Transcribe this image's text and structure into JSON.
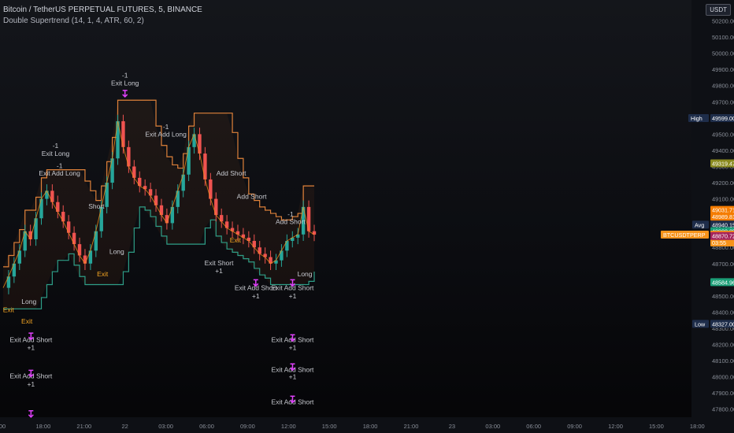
{
  "header": {
    "title": "Bitcoin / TetherUS PERPETUAL FUTURES, 5, BINANCE",
    "indicator": "Double Supertrend (14, 1, 4, ATR, 60, 2)"
  },
  "currency_button": "USDT",
  "colors": {
    "up": "#26a69a",
    "down": "#ef5350",
    "wick_up": "#26a69a",
    "wick_down": "#ef5350",
    "supertrend_up": "#2e9e87",
    "supertrend_down": "#e0823a",
    "exit_marker": "#e040fb",
    "long_marker": "#4dd0e1",
    "exit_text": "#f5a623",
    "price_tag": "#f7931a",
    "avg_tag": "#1e2d4a",
    "high_tag": "#1e2d4a",
    "low_tag": "#1e2d4a"
  },
  "chart_data": {
    "type": "line",
    "title": "Bitcoin / TetherUS PERPETUAL FUTURES, 5, BINANCE",
    "ylim": [
      47750,
      50300
    ],
    "y_ticks": [
      "50200.00",
      "50100.00",
      "50000.00",
      "49900.00",
      "49800.00",
      "49700.00",
      "49600.00",
      "49500.00",
      "49400.00",
      "49300.00",
      "49200.00",
      "49100.00",
      "49000.00",
      "48900.00",
      "48800.00",
      "48700.00",
      "48600.00",
      "48500.00",
      "48400.00",
      "48300.00",
      "48200.00",
      "48100.00",
      "48000.00",
      "47900.00",
      "47800.00"
    ],
    "x_ticks": [
      {
        "label": "00",
        "t": 0
      },
      {
        "label": "18:00",
        "t": 1
      },
      {
        "label": "21:00",
        "t": 2
      },
      {
        "label": "22",
        "t": 3
      },
      {
        "label": "03:00",
        "t": 4
      },
      {
        "label": "06:00",
        "t": 5
      },
      {
        "label": "09:00",
        "t": 6
      },
      {
        "label": "12:00",
        "t": 7
      },
      {
        "label": "15:00",
        "t": 8
      },
      {
        "label": "18:00",
        "t": 9
      },
      {
        "label": "21:00",
        "t": 10
      },
      {
        "label": "23",
        "t": 11
      },
      {
        "label": "03:00",
        "t": 12
      },
      {
        "label": "06:00",
        "t": 13
      },
      {
        "label": "09:00",
        "t": 14
      },
      {
        "label": "12:00",
        "t": 15
      },
      {
        "label": "15:00",
        "t": 16
      },
      {
        "label": "18:00",
        "t": 17
      }
    ],
    "price_close": [
      48550,
      48620,
      48700,
      48780,
      48900,
      48850,
      48980,
      49100,
      49150,
      49080,
      49020,
      48960,
      48890,
      48820,
      48750,
      48700,
      48780,
      48900,
      49050,
      49200,
      49350,
      49580,
      49420,
      49300,
      49230,
      49180,
      49160,
      49120,
      49060,
      49000,
      48950,
      49050,
      49150,
      49250,
      49420,
      49500,
      49380,
      49220,
      49100,
      49000,
      48960,
      48920,
      48900,
      48880,
      48860,
      48840,
      48800,
      48760,
      48740,
      48700,
      48720,
      48780,
      48840,
      48860,
      48880,
      49050,
      48900,
      48878.79
    ],
    "series": [
      {
        "name": "",
        "values": []
      }
    ],
    "price_labels": [
      {
        "label": "High",
        "value": "49599.00"
      },
      {
        "label": "",
        "value": "49319.47"
      },
      {
        "label": "",
        "value": "49031.71"
      },
      {
        "label": "",
        "value": "48989.81"
      },
      {
        "label": "Avg",
        "value": "48940.15"
      },
      {
        "label": "",
        "value": "48900.25"
      },
      {
        "label": "BTCUSDTPERP",
        "value": "48878.79",
        "sub": "03:55"
      },
      {
        "label": "",
        "value": "48870.72"
      },
      {
        "label": "",
        "value": "48584.96"
      },
      {
        "label": "Low",
        "value": "48327.00"
      }
    ],
    "annotations": [
      {
        "text": "-1",
        "t": 3.0,
        "y": 49850
      },
      {
        "text": "Exit Long",
        "t": 3.0,
        "y": 49800
      },
      {
        "text": "-1",
        "t": 1.3,
        "y": 49415
      },
      {
        "text": "Exit Long",
        "t": 1.3,
        "y": 49365
      },
      {
        "text": "-1",
        "t": 1.4,
        "y": 49290
      },
      {
        "text": "Exit Add Long",
        "t": 1.4,
        "y": 49245
      },
      {
        "text": "-1",
        "t": 4.0,
        "y": 49530
      },
      {
        "text": "Exit Add Long",
        "t": 4.0,
        "y": 49485
      },
      {
        "text": "Add Short",
        "t": 5.6,
        "y": 49245
      },
      {
        "text": "Add Short",
        "t": 6.1,
        "y": 49100
      },
      {
        "text": "Exit Short",
        "t": 5.3,
        "y": 48690
      },
      {
        "text": "+1",
        "t": 5.3,
        "y": 48640
      },
      {
        "text": "Exit Add Short",
        "t": 6.2,
        "y": 48535
      },
      {
        "text": "+1",
        "t": 6.2,
        "y": 48485
      },
      {
        "text": "-1",
        "t": 7.05,
        "y": 48990
      },
      {
        "text": "Add Short",
        "t": 7.05,
        "y": 48945
      },
      {
        "text": "Exit Add Short",
        "t": 7.1,
        "y": 48535
      },
      {
        "text": "+1",
        "t": 7.1,
        "y": 48485
      },
      {
        "text": "Exit Add Short",
        "t": 0.7,
        "y": 48215
      },
      {
        "text": "+1",
        "t": 0.7,
        "y": 48165
      },
      {
        "text": "Exit Add Short",
        "t": 0.7,
        "y": 47990
      },
      {
        "text": "+1",
        "t": 0.7,
        "y": 47940
      },
      {
        "text": "Exit Add Short",
        "t": 7.1,
        "y": 48215
      },
      {
        "text": "+1",
        "t": 7.1,
        "y": 48165
      },
      {
        "text": "Exit Add Short",
        "t": 7.1,
        "y": 48030
      },
      {
        "text": "+1",
        "t": 7.1,
        "y": 47985
      },
      {
        "text": "Exit Add Short",
        "t": 7.1,
        "y": 47830
      },
      {
        "text": "Short",
        "t": 2.3,
        "y": 49040
      },
      {
        "text": "Long",
        "t": 2.8,
        "y": 48760
      },
      {
        "text": "Exit",
        "t": 2.45,
        "y": 48620
      },
      {
        "text": "Long",
        "t": 0.65,
        "y": 48450
      },
      {
        "text": "Exit",
        "t": 0.15,
        "y": 48400
      },
      {
        "text": "Exit",
        "t": 0.6,
        "y": 48330
      },
      {
        "text": "Long",
        "t": 7.4,
        "y": 48620
      },
      {
        "text": "Exit",
        "t": 5.7,
        "y": 48830
      }
    ]
  }
}
